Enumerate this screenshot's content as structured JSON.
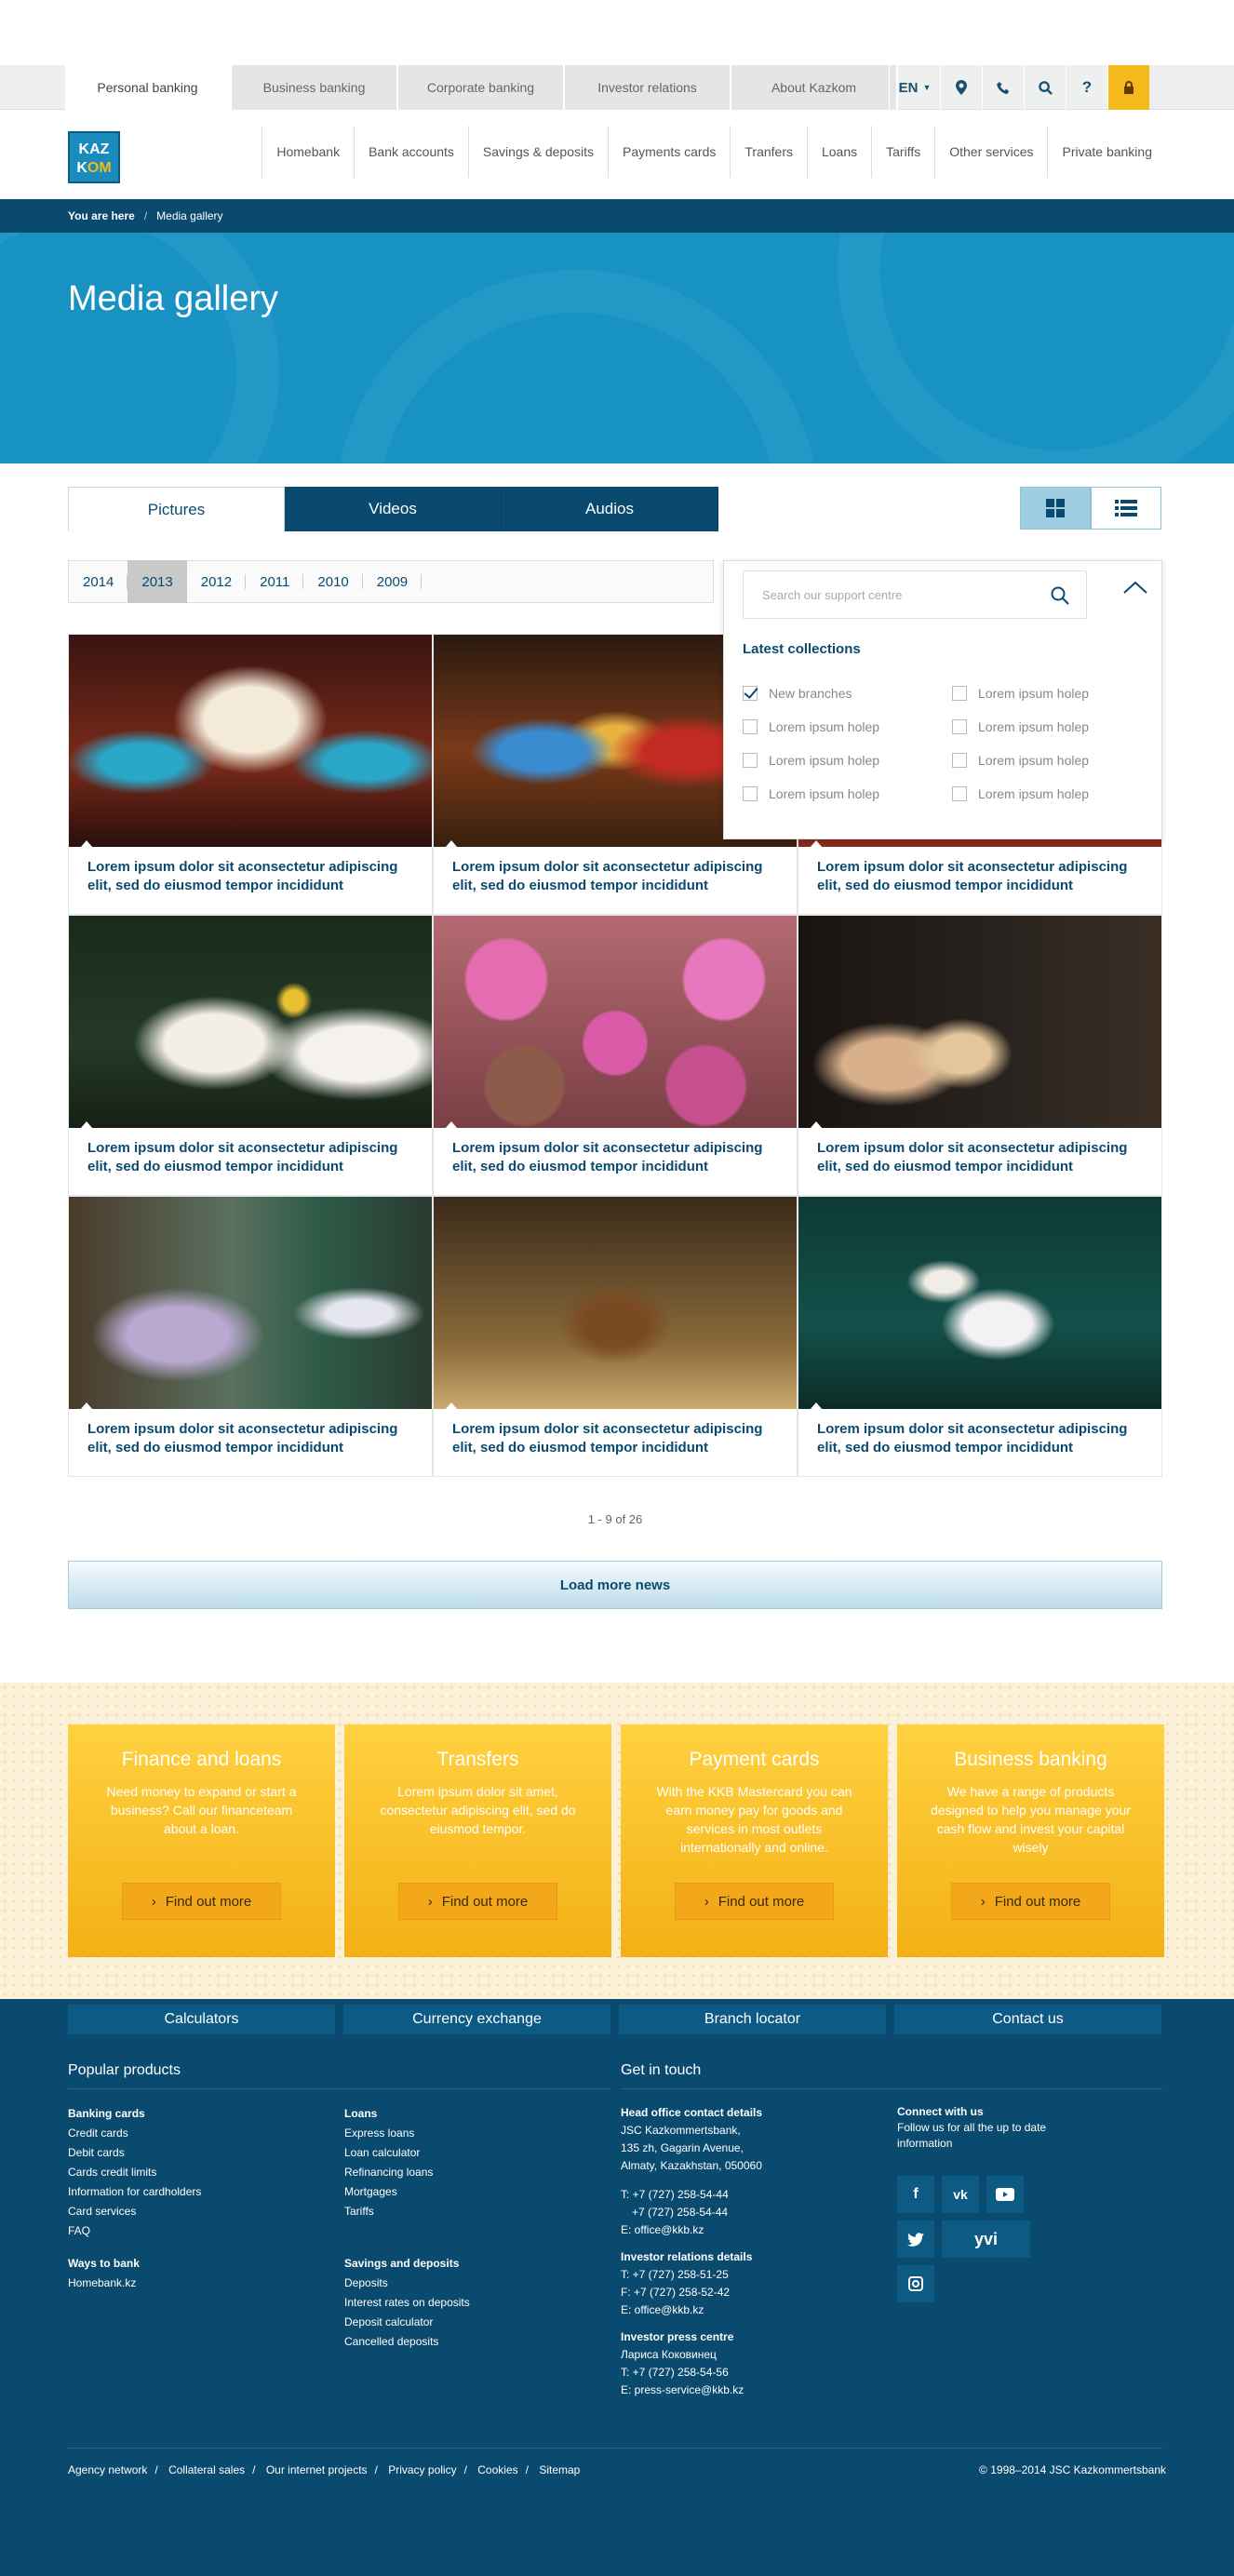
{
  "top_tabs": [
    "Personal banking",
    "Business banking",
    "Corporate banking",
    "Investor relations",
    "About Kazkom"
  ],
  "language": "EN",
  "logo": {
    "line1": "KAZ",
    "line2a": "K",
    "line2b": "OM"
  },
  "main_nav": [
    "Homebank",
    "Bank accounts",
    "Savings & deposits",
    "Payments cards",
    "Tranfers",
    "Loans",
    "Tariffs",
    "Other services",
    "Private banking"
  ],
  "breadcrumb": {
    "label": "You are here",
    "sep": "/",
    "current": "Media gallery"
  },
  "page_title": "Media gallery",
  "media_tabs": [
    "Pictures",
    "Videos",
    "Audios"
  ],
  "years": [
    "2014",
    "2013",
    "2012",
    "2011",
    "2010",
    "2009"
  ],
  "filter": {
    "search_placeholder": "Search our support centre",
    "collections_title": "Latest collections",
    "items": [
      "New branches",
      "Lorem ipsum holep",
      "Lorem ipsum holep",
      "Lorem ipsum holep",
      "Lorem ipsum holep",
      "Lorem ipsum holep",
      "Lorem ipsum holep",
      "Lorem ipsum holep"
    ],
    "checked": [
      true,
      false,
      false,
      false,
      false,
      false,
      false,
      false
    ]
  },
  "gallery_caption": "Lorem ipsum dolor sit aconsectetur adipiscing elit, sed do eiusmod tempor incididunt",
  "pager": "1 - 9 of 26",
  "load_more": "Load more news",
  "promos": [
    {
      "title": "Finance and loans",
      "text": "Need money to expand or start a business? Call our financeteam about a loan.",
      "btn": "Find out more"
    },
    {
      "title": "Transfers",
      "text": "Lorem ipsum dolor sit amet, consectetur adipiscing elit, sed do eiusmod tempor.",
      "btn": "Find out more"
    },
    {
      "title": "Payment cards",
      "text": "With the KKB Mastercard you can earn money pay for goods and services in most outlets internationally and online.",
      "btn": "Find out more"
    },
    {
      "title": "Business banking",
      "text": "We have a range of products designed to help you manage your cash flow and invest your capital wisely",
      "btn": "Find out more"
    }
  ],
  "footer": {
    "buttons": [
      "Calculators",
      "Currency exchange",
      "Branch locator",
      "Contact us"
    ],
    "popular_title": "Popular products",
    "contact_title": "Get in touch",
    "banking_cards": {
      "title": "Banking cards",
      "items": [
        "Credit cards",
        "Debit cards",
        "Cards credit limits",
        "Information for cardholders",
        "Card services",
        "FAQ"
      ]
    },
    "ways": {
      "title": "Ways to bank",
      "items": [
        "Homebank.kz"
      ]
    },
    "loans": {
      "title": "Loans",
      "items": [
        "Express loans",
        "Loan calculator",
        "Refinancing loans",
        "Mortgages",
        "Tariffs"
      ]
    },
    "savings": {
      "title": "Savings and deposits",
      "items": [
        "Deposits",
        "Interest rates on deposits",
        "Deposit calculator",
        "Cancelled deposits"
      ]
    },
    "head_office": {
      "title": "Head office contact details",
      "lines": [
        "JSC Kazkommertsbank,",
        "135 zh, Gagarin Avenue,",
        "Almaty, Kazakhstan, 050060"
      ],
      "t": "T: +7 (727) 258-54-44",
      "t2": "+7 (727) 258-54-44",
      "e": "E: office@kkb.kz"
    },
    "investor": {
      "title": "Investor relations details",
      "t": "T: +7 (727) 258-51-25",
      "f": "F: +7 (727) 258-52-42",
      "e": "E: office@kkb.kz"
    },
    "press": {
      "title": "Investor press centre",
      "name": "Лариса Коковинец",
      "t": "T: +7 (727) 258-54-56",
      "e": "E: press-service@kkb.kz"
    },
    "connect": {
      "title": "Connect with us",
      "text": "Follow us for all the up to date information"
    },
    "legal": [
      "Agency network",
      "Collateral sales",
      "Our internet projects",
      "Privacy policy",
      "Cookies",
      "Sitemap"
    ],
    "copyright": "© 1998–2014 JSC Kazkommertsbank"
  }
}
